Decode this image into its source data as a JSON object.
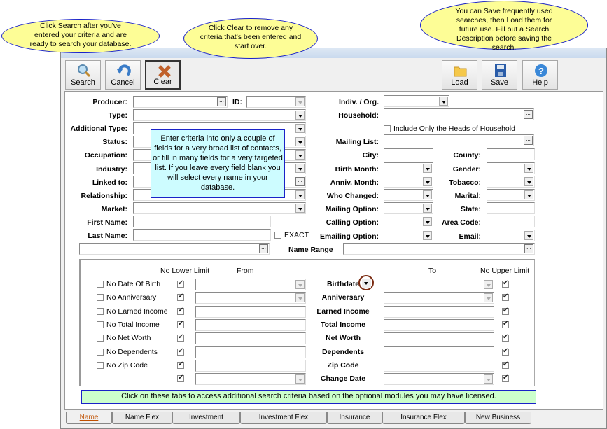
{
  "callouts": {
    "search": "Click Search after you've entered your criteria and are ready to search your database.",
    "clear": "Click Clear to remove any criteria that's been entered and start over.",
    "save": "You can Save frequently used searches, then Load them for future use. Fill out a Search Description before saving the search.",
    "fields_tip": "Enter criteria into only a couple of fields for a very broad list of contacts, or fill in many fields for a very targeted list. If you leave every field blank you will select every name in your database.",
    "tabs_tip": "Click on these tabs to access additional search criteria based on the optional modules you may have licensed."
  },
  "toolbar": {
    "search": "Search",
    "cancel": "Cancel",
    "clear": "Clear",
    "load": "Load",
    "save": "Save",
    "help": "Help"
  },
  "left_fields": {
    "producer": "Producer:",
    "id": "ID:",
    "type": "Type:",
    "additional_type": "Additional Type:",
    "status": "Status:",
    "occupation": "Occupation:",
    "industry": "Industry:",
    "linked_to": "Linked to:",
    "relationship": "Relationship:",
    "market": "Market:",
    "first_name": "First Name:",
    "last_name": "Last Name:",
    "exact": "EXACT",
    "name_range": "Name Range"
  },
  "right_fields": {
    "indiv_org": "Indiv. / Org.",
    "household": "Household:",
    "heads_only": "Include Only the Heads of Household",
    "mailing_list": "Mailing List:",
    "city": "City:",
    "county": "County:",
    "birth_month": "Birth Month:",
    "gender": "Gender:",
    "anniv_month": "Anniv. Month:",
    "tobacco": "Tobacco:",
    "who_changed": "Who Changed:",
    "marital": "Marital:",
    "mailing_option": "Mailing Option:",
    "state": "State:",
    "calling_option": "Calling Option:",
    "area_code": "Area Code:",
    "emailing_option": "Emailing Option:",
    "email": "Email:"
  },
  "range": {
    "no_lower": "No Lower Limit",
    "from": "From",
    "to": "To",
    "no_upper": "No Upper Limit",
    "rows": [
      {
        "no_label": "No Date Of Birth",
        "label": "Birthdate"
      },
      {
        "no_label": "No Anniversary",
        "label": "Anniversary"
      },
      {
        "no_label": "No Earned Income",
        "label": "Earned Income"
      },
      {
        "no_label": "No Total Income",
        "label": "Total Income"
      },
      {
        "no_label": "No Net Worth",
        "label": "Net Worth"
      },
      {
        "no_label": "No Dependents",
        "label": "Dependents"
      },
      {
        "no_label": "No Zip Code",
        "label": "Zip Code"
      },
      {
        "no_label": "",
        "label": "Change Date"
      }
    ]
  },
  "tabs": [
    "Name",
    "Name Flex",
    "Investment",
    "Investment Flex",
    "Insurance",
    "Insurance Flex",
    "New Business"
  ],
  "active_tab": "Name"
}
